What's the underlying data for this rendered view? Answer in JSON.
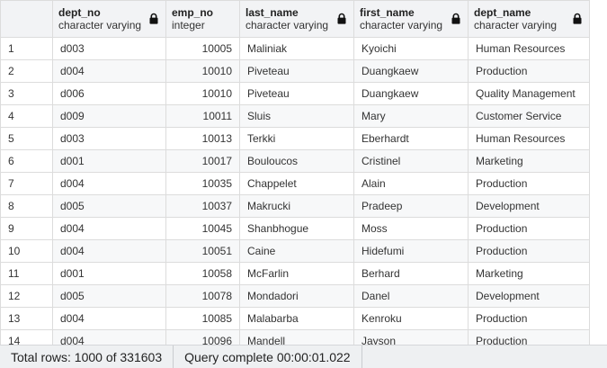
{
  "grid": {
    "columns": [
      {
        "name": "dept_no",
        "type": "character varying"
      },
      {
        "name": "emp_no",
        "type": "integer"
      },
      {
        "name": "last_name",
        "type": "character varying"
      },
      {
        "name": "first_name",
        "type": "character varying"
      },
      {
        "name": "dept_name",
        "type": "character varying"
      }
    ],
    "rows": [
      {
        "n": "1",
        "dept_no": "d003",
        "emp_no": "10005",
        "last_name": "Maliniak",
        "first_name": "Kyoichi",
        "dept_name": "Human Resources"
      },
      {
        "n": "2",
        "dept_no": "d004",
        "emp_no": "10010",
        "last_name": "Piveteau",
        "first_name": "Duangkaew",
        "dept_name": "Production"
      },
      {
        "n": "3",
        "dept_no": "d006",
        "emp_no": "10010",
        "last_name": "Piveteau",
        "first_name": "Duangkaew",
        "dept_name": "Quality Management"
      },
      {
        "n": "4",
        "dept_no": "d009",
        "emp_no": "10011",
        "last_name": "Sluis",
        "first_name": "Mary",
        "dept_name": "Customer Service"
      },
      {
        "n": "5",
        "dept_no": "d003",
        "emp_no": "10013",
        "last_name": "Terkki",
        "first_name": "Eberhardt",
        "dept_name": "Human Resources"
      },
      {
        "n": "6",
        "dept_no": "d001",
        "emp_no": "10017",
        "last_name": "Bouloucos",
        "first_name": "Cristinel",
        "dept_name": "Marketing"
      },
      {
        "n": "7",
        "dept_no": "d004",
        "emp_no": "10035",
        "last_name": "Chappelet",
        "first_name": "Alain",
        "dept_name": "Production"
      },
      {
        "n": "8",
        "dept_no": "d005",
        "emp_no": "10037",
        "last_name": "Makrucki",
        "first_name": "Pradeep",
        "dept_name": "Development"
      },
      {
        "n": "9",
        "dept_no": "d004",
        "emp_no": "10045",
        "last_name": "Shanbhogue",
        "first_name": "Moss",
        "dept_name": "Production"
      },
      {
        "n": "10",
        "dept_no": "d004",
        "emp_no": "10051",
        "last_name": "Caine",
        "first_name": "Hidefumi",
        "dept_name": "Production"
      },
      {
        "n": "11",
        "dept_no": "d001",
        "emp_no": "10058",
        "last_name": "McFarlin",
        "first_name": "Berhard",
        "dept_name": "Marketing"
      },
      {
        "n": "12",
        "dept_no": "d005",
        "emp_no": "10078",
        "last_name": "Mondadori",
        "first_name": "Danel",
        "dept_name": "Development"
      },
      {
        "n": "13",
        "dept_no": "d004",
        "emp_no": "10085",
        "last_name": "Malabarba",
        "first_name": "Kenroku",
        "dept_name": "Production"
      },
      {
        "n": "14",
        "dept_no": "d004",
        "emp_no": "10096",
        "last_name": "Mandell",
        "first_name": "Jayson",
        "dept_name": "Production"
      }
    ]
  },
  "status": {
    "total_rows": "Total rows: 1000 of 331603",
    "query_complete": "Query complete 00:00:01.022"
  },
  "icons": {
    "column_lock": "lock-icon"
  },
  "colors": {
    "header_bg": "#f2f3f5",
    "status_bg": "#eef0f2",
    "grid_line": "#dcdcdc"
  }
}
